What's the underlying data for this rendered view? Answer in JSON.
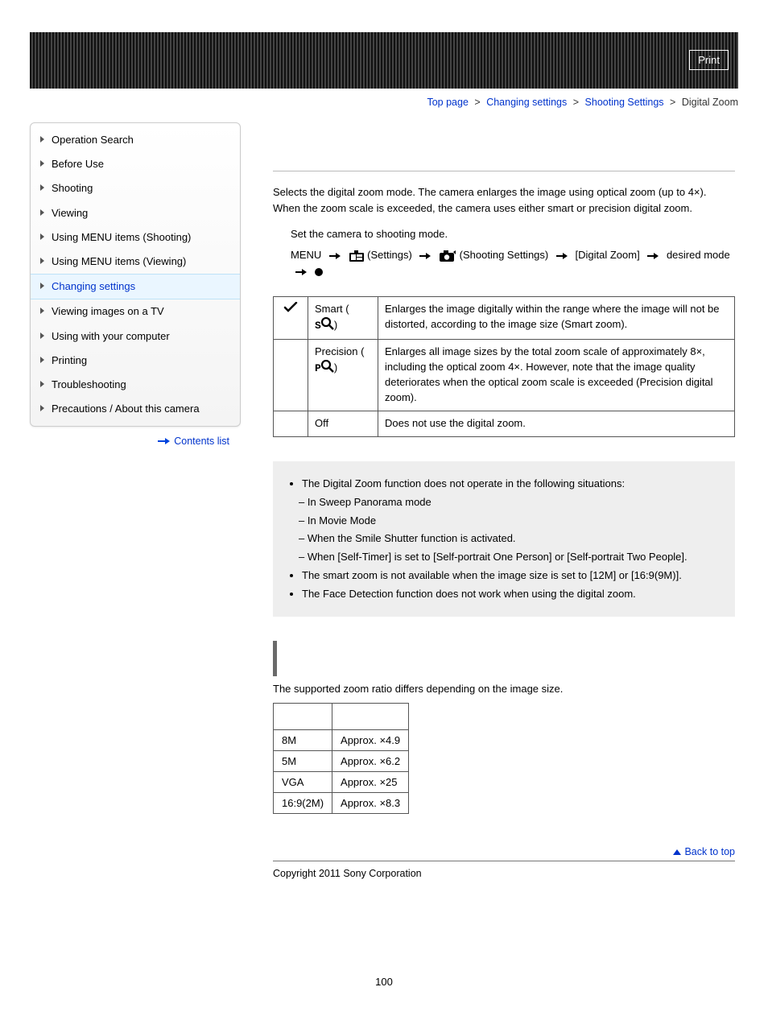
{
  "print_label": "Print",
  "breadcrumb": {
    "top": "Top page",
    "a": "Changing settings",
    "b": "Shooting Settings",
    "current": "Digital Zoom",
    "sep": ">"
  },
  "sidebar": {
    "items": [
      "Operation Search",
      "Before Use",
      "Shooting",
      "Viewing",
      "Using MENU items (Shooting)",
      "Using MENU items (Viewing)",
      "Changing settings",
      "Viewing images on a TV",
      "Using with your computer",
      "Printing",
      "Troubleshooting",
      "Precautions / About this camera"
    ],
    "active_index": 6,
    "contents_list": "Contents list"
  },
  "intro": "Selects the digital zoom mode. The camera enlarges the image using optical zoom (up to 4×). When the zoom scale is exceeded, the camera uses either smart or precision digital zoom.",
  "step1": "Set the camera to shooting mode.",
  "menu_path": {
    "menu": "MENU",
    "settings": "(Settings)",
    "shooting": "(Shooting Settings)",
    "digital": "[Digital Zoom]",
    "desired": "desired mode"
  },
  "options": [
    {
      "checked": true,
      "label_pre": "Smart (",
      "label_suf": ")",
      "mag_prefix": "S",
      "desc": "Enlarges the image digitally within the range where the image will not be distorted, according to the image size (Smart zoom)."
    },
    {
      "checked": false,
      "label_pre": "Precision (",
      "label_suf": ")",
      "mag_prefix": "P",
      "desc": "Enlarges all image sizes by the total zoom scale of approximately 8×, including the optical zoom 4×. However, note that the image quality deteriorates when the optical zoom scale is exceeded (Precision digital zoom)."
    },
    {
      "checked": false,
      "label_pre": "Off",
      "label_suf": "",
      "mag_prefix": "",
      "desc": "Does not use the digital zoom."
    }
  ],
  "notes": {
    "n1": "The Digital Zoom function does not operate in the following situations:",
    "sub": [
      "In Sweep Panorama mode",
      "In Movie Mode",
      "When the Smile Shutter function is activated.",
      "When [Self-Timer] is set to [Self-portrait One Person] or [Self-portrait Two People]."
    ],
    "n2": "The smart zoom is not available when the image size is set to [12M] or [16:9(9M)].",
    "n3": "The Face Detection function does not work when using the digital zoom."
  },
  "ratio_intro": "The supported zoom ratio differs depending on the image size.",
  "ratio_table": [
    {
      "size": "8M",
      "zoom": "Approx. ×4.9"
    },
    {
      "size": "5M",
      "zoom": "Approx. ×6.2"
    },
    {
      "size": "VGA",
      "zoom": "Approx. ×25"
    },
    {
      "size": "16:9(2M)",
      "zoom": "Approx. ×8.3"
    }
  ],
  "back_to_top": "Back to top",
  "copyright": "Copyright 2011 Sony Corporation",
  "page_number": "100"
}
